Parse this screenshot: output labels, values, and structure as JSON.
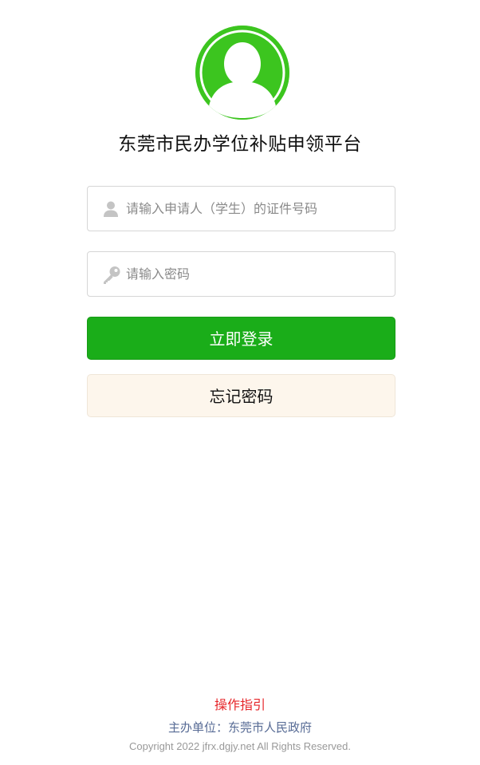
{
  "header": {
    "title": "东莞市民办学位补贴申领平台",
    "avatar_icon": "user-avatar-icon",
    "avatar_color": "#3cc51f"
  },
  "form": {
    "id_field": {
      "value": "",
      "placeholder": "请输入申请人（学生）的证件号码",
      "icon": "user-icon"
    },
    "password_field": {
      "value": "",
      "placeholder": "请输入密码",
      "icon": "key-icon"
    },
    "login_label": "立即登录",
    "forgot_label": "忘记密码"
  },
  "footer": {
    "guide_link": "操作指引",
    "organizer": "主办单位：东莞市人民政府",
    "copyright": "Copyright 2022 jfrx.dgjy.net All Rights Reserved."
  },
  "colors": {
    "primary": "#1aad19",
    "forgot_bg": "#fdf6ec",
    "guide_link": "#e6262a",
    "organizer_text": "#576b95",
    "copyright_text": "#999999"
  }
}
